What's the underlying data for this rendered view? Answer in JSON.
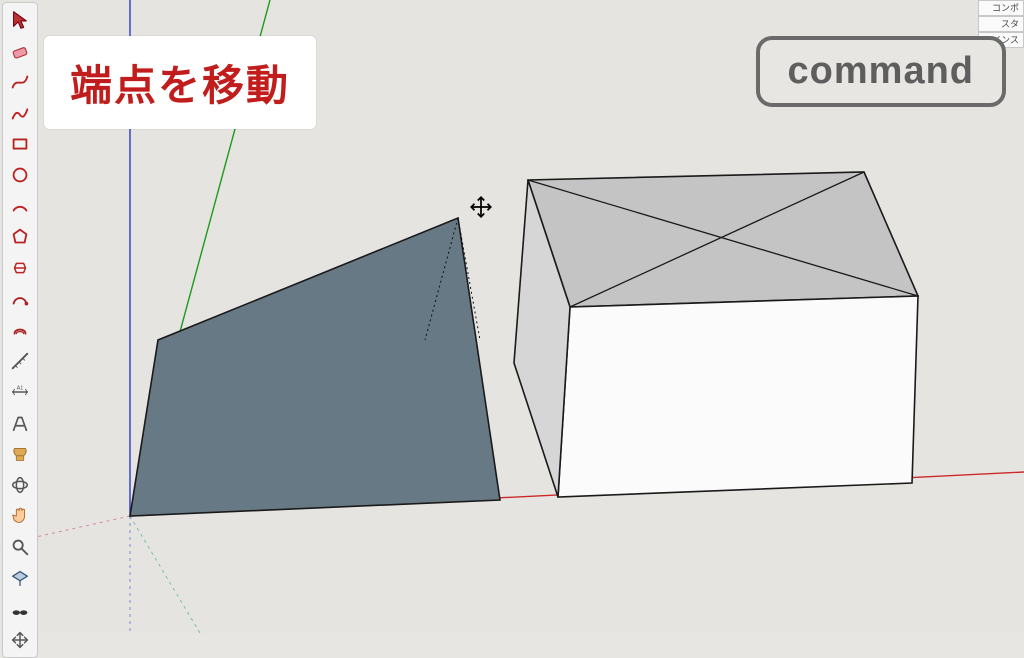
{
  "app": {
    "overlay_label": "端点を移動",
    "command_badge": "command"
  },
  "trays": {
    "tab1": "コンポ",
    "tab2": "スタ",
    "tab3": "インス"
  },
  "tools": [
    {
      "name": "select-tool"
    },
    {
      "name": "eraser-tool"
    },
    {
      "name": "line-tool"
    },
    {
      "name": "freehand-tool"
    },
    {
      "name": "rectangle-tool"
    },
    {
      "name": "circle-tool"
    },
    {
      "name": "arc-tool"
    },
    {
      "name": "polygon-tool"
    },
    {
      "name": "pushpull-tool"
    },
    {
      "name": "followme-tool"
    },
    {
      "name": "offset-tool"
    },
    {
      "name": "tape-measure-tool"
    },
    {
      "name": "dimension-tool"
    },
    {
      "name": "text-tool"
    },
    {
      "name": "paint-bucket-tool"
    },
    {
      "name": "orbit-tool"
    },
    {
      "name": "pan-tool"
    },
    {
      "name": "zoom-tool"
    },
    {
      "name": "section-plane-tool"
    },
    {
      "name": "walk-tool"
    },
    {
      "name": "position-camera-tool"
    }
  ],
  "colors": {
    "axis_red": "#cc2a2a",
    "axis_green": "#1c9a1c",
    "axis_blue": "#2a3acc",
    "face_shade": "#667985",
    "cube_top": "#b8b8b8",
    "cube_front": "#fafafa",
    "cube_side": "#cfcfcf"
  }
}
